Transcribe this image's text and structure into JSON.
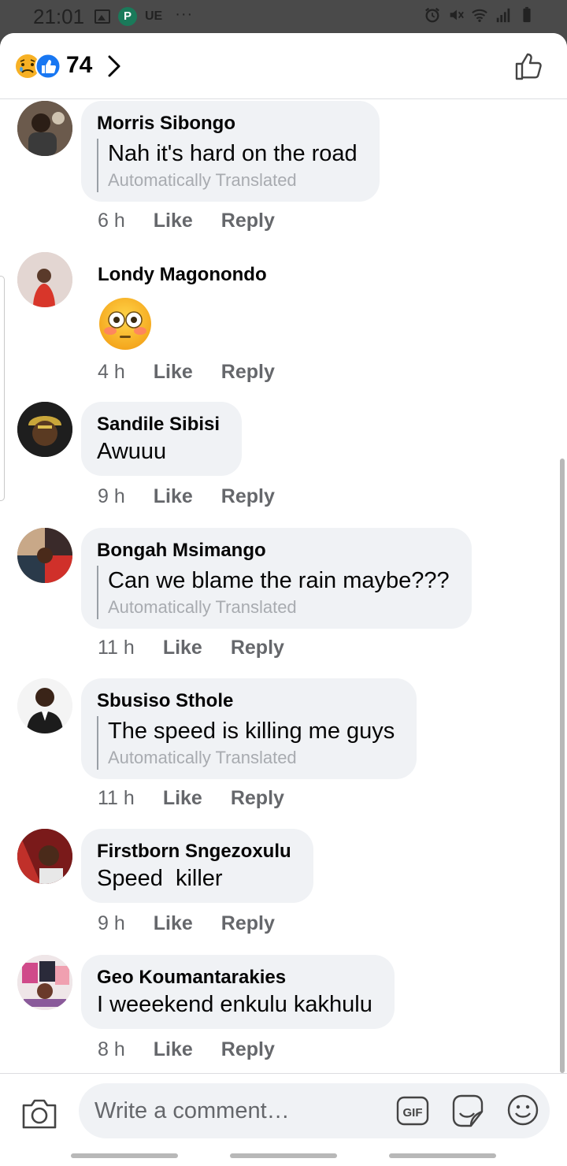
{
  "status_bar": {
    "time": "21:01",
    "carrier_label": "UE",
    "app_letter": "P",
    "more_label": "···"
  },
  "header": {
    "reaction_count": "74"
  },
  "comments": [
    {
      "name": "Morris Sibongo",
      "text": "Nah it's hard on the road",
      "translated_label": "Automatically Translated",
      "time": "6 h",
      "like": "Like",
      "reply": "Reply"
    },
    {
      "name": "Londy Magonondo",
      "text": "",
      "emoji": "flushed-face",
      "time": "4 h",
      "like": "Like",
      "reply": "Reply"
    },
    {
      "name": "Sandile Sibisi",
      "text": "Awuuu",
      "time": "9 h",
      "like": "Like",
      "reply": "Reply"
    },
    {
      "name": "Bongah Msimango",
      "text": "Can we blame the rain maybe???",
      "translated_label": "Automatically Translated",
      "time": "11 h",
      "like": "Like",
      "reply": "Reply"
    },
    {
      "name": "Sbusiso Sthole",
      "text": "The speed is killing me guys",
      "translated_label": "Automatically Translated",
      "time": "11 h",
      "like": "Like",
      "reply": "Reply"
    },
    {
      "name": "Firstborn Sngezoxulu",
      "text": "Speed  killer",
      "time": "9 h",
      "like": "Like",
      "reply": "Reply"
    },
    {
      "name": "Geo Koumantarakies",
      "text": "I weeekend enkulu kakhulu",
      "time": "8 h",
      "like": "Like",
      "reply": "Reply"
    }
  ],
  "composer": {
    "placeholder": "Write a comment…",
    "gif_label": "GIF"
  },
  "colors": {
    "bubble": "#f0f2f5",
    "meta": "#65676b",
    "like_blue": "#1877f2"
  }
}
